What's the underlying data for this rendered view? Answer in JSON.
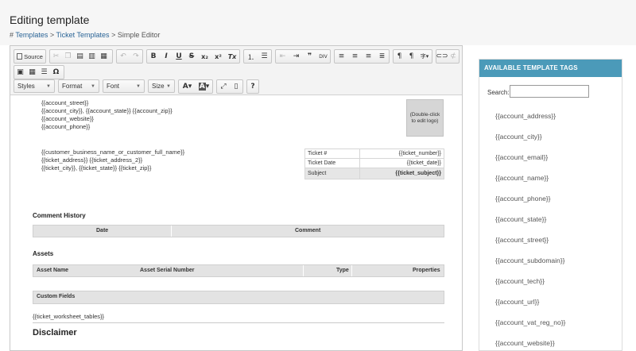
{
  "page": {
    "title": "Editing template",
    "breadcrumb": {
      "hash": "#",
      "templates": "Templates",
      "sep": ">",
      "ticket_templates": "Ticket Templates",
      "current": "Simple Editor"
    }
  },
  "toolbar": {
    "source_label": "Source",
    "styles_label": "Styles",
    "format_label": "Format",
    "font_label": "Font",
    "size_label": "Size",
    "bold": "B",
    "italic": "I",
    "underline": "U",
    "strike": "S",
    "subscript": "x₂",
    "superscript": "x²",
    "remove_format": "Tx",
    "help": "?",
    "omega": "Ω",
    "icons": [
      "source-icon",
      "cut-icon",
      "copy-icon",
      "paste-icon",
      "paste-text-icon",
      "paste-word-icon",
      "undo-icon",
      "redo-icon",
      "numbered-list-icon",
      "bulleted-list-icon",
      "outdent-icon",
      "indent-icon",
      "blockquote-icon",
      "div-icon",
      "align-left-icon",
      "align-center-icon",
      "align-right-icon",
      "justify-icon",
      "ltr-icon",
      "rtl-icon",
      "language-icon",
      "link-icon",
      "unlink-icon",
      "image-icon",
      "table-icon",
      "horizontal-line-icon",
      "special-char-icon",
      "text-color-icon",
      "bg-color-icon",
      "maximize-icon",
      "show-blocks-icon",
      "help-icon"
    ]
  },
  "document": {
    "account_lines": [
      "{{account_street}}",
      "{{account_city}}, {{account_state}} {{account_zip}}",
      "{{account_website}}",
      "{{account_phone}}"
    ],
    "logo_text": [
      "(Double-click",
      "to edit logo)"
    ],
    "customer_lines": [
      "{{customer_business_name_or_customer_full_name}}",
      "{{ticket_address}} {{ticket_address_2}}",
      "{{ticket_city}}, {{ticket_state}} {{ticket_zip}}"
    ],
    "ticket_info": [
      {
        "label": "Ticket #",
        "value": "{{ticket_number}}"
      },
      {
        "label": "Ticket Date",
        "value": "{{ticket_date}}"
      },
      {
        "label": "Subject",
        "value": "{{ticket_subject}}"
      }
    ],
    "comment_history_title": "Comment History",
    "comment_cols": [
      "Date",
      "Comment"
    ],
    "assets_title": "Assets",
    "asset_cols": [
      "Asset Name",
      "Asset Serial Number",
      "Type",
      "Properties"
    ],
    "custom_fields": "Custom Fields",
    "worksheet_tag": "{{ticket_worksheet_tables}}",
    "disclaimer": "Disclaimer"
  },
  "panel": {
    "title": "AVAILABLE TEMPLATE TAGS",
    "search_label": "Search:",
    "search_value": "",
    "tags": [
      "{{account_address}}",
      "{{account_city}}",
      "{{account_email}}",
      "{{account_name}}",
      "{{account_phone}}",
      "{{account_state}}",
      "{{account_street}}",
      "{{account_subdomain}}",
      "{{account_tech}}",
      "{{account_url}}",
      "{{account_vat_reg_no}}",
      "{{account_website}}"
    ]
  },
  "colors": {
    "panel_header": "#4b9ab9",
    "link": "#2a6496",
    "table_header": "#e3e3e3"
  }
}
